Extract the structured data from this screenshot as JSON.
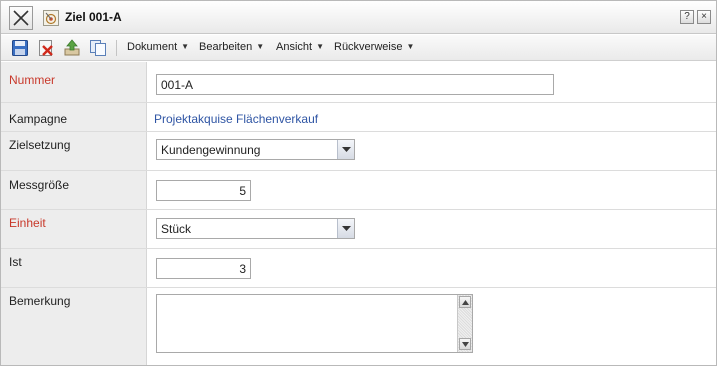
{
  "window": {
    "title": "Ziel 001-A",
    "help_label": "?",
    "close_label": "×"
  },
  "icons": {
    "close": "close-x-icon",
    "title": "target-goal-icon",
    "save": "save-icon",
    "delete": "delete-icon",
    "upload": "upload-icon",
    "copy": "copy-icon"
  },
  "toolbar": {
    "menus": [
      {
        "label": "Dokument"
      },
      {
        "label": "Bearbeiten"
      },
      {
        "label": "Ansicht"
      },
      {
        "label": "Rückverweise"
      }
    ]
  },
  "form": {
    "nummer": {
      "label": "Nummer",
      "value": "001-A",
      "required": true
    },
    "kampagne": {
      "label": "Kampagne",
      "value": "Projektakquise Flächenverkauf"
    },
    "zielsetzung": {
      "label": "Zielsetzung",
      "value": "Kundengewinnung"
    },
    "messgroesse": {
      "label": "Messgröße",
      "value": "5"
    },
    "einheit": {
      "label": "Einheit",
      "value": "Stück",
      "required": true
    },
    "ist": {
      "label": "Ist",
      "value": "3"
    },
    "bemerkung": {
      "label": "Bemerkung",
      "value": ""
    }
  },
  "colors": {
    "required_label": "#c8382a",
    "link": "#2f55a4",
    "label_background": "#ededed"
  }
}
